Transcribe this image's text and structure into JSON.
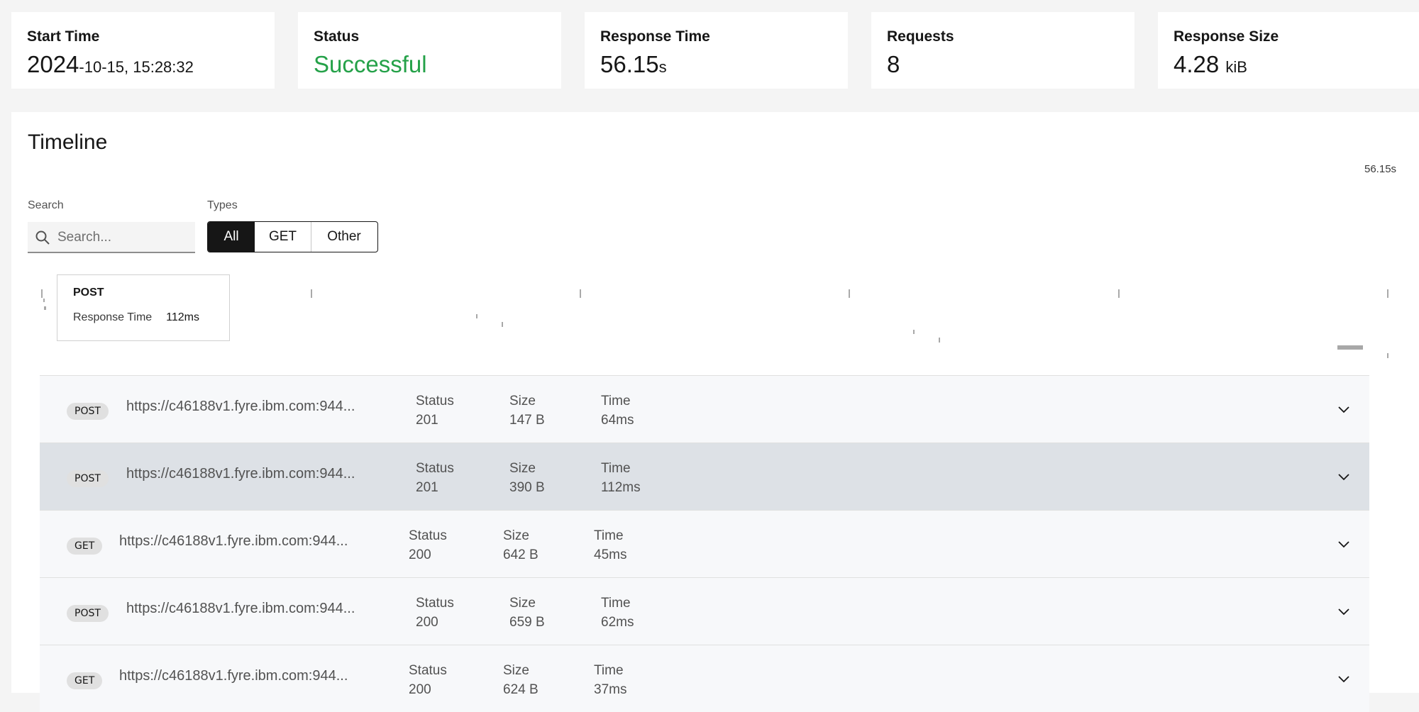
{
  "summary": {
    "start_time": {
      "label": "Start Time",
      "value_main": "2024",
      "value_rest": "-10-15, 15:28:32"
    },
    "status": {
      "label": "Status",
      "value": "Successful",
      "color": "#24a148"
    },
    "response_time": {
      "label": "Response Time",
      "value": "56.15",
      "unit": "s"
    },
    "requests": {
      "label": "Requests",
      "value": "8"
    },
    "response_size": {
      "label": "Response Size",
      "value": "4.28",
      "unit": "kiB"
    }
  },
  "timeline": {
    "title": "Timeline",
    "search": {
      "label": "Search",
      "placeholder": "Search..."
    },
    "types": {
      "label": "Types",
      "options": [
        "All",
        "GET",
        "Other"
      ],
      "selected": "All"
    },
    "axis_end_label": "56.15s",
    "tooltip": {
      "method": "POST",
      "metric_label": "Response Time",
      "metric_value": "112ms"
    }
  },
  "requests": [
    {
      "method": "POST",
      "url": "https://c46188v1.fyre.ibm.com:944...",
      "status_label": "Status",
      "status": "201",
      "size_label": "Size",
      "size": "147 B",
      "time_label": "Time",
      "time": "64ms"
    },
    {
      "method": "POST",
      "url": "https://c46188v1.fyre.ibm.com:944...",
      "status_label": "Status",
      "status": "201",
      "size_label": "Size",
      "size": "390 B",
      "time_label": "Time",
      "time": "112ms"
    },
    {
      "method": "GET",
      "url": "https://c46188v1.fyre.ibm.com:944...",
      "status_label": "Status",
      "status": "200",
      "size_label": "Size",
      "size": "642 B",
      "time_label": "Time",
      "time": "45ms"
    },
    {
      "method": "POST",
      "url": "https://c46188v1.fyre.ibm.com:944...",
      "status_label": "Status",
      "status": "200",
      "size_label": "Size",
      "size": "659 B",
      "time_label": "Time",
      "time": "62ms"
    },
    {
      "method": "GET",
      "url": "https://c46188v1.fyre.ibm.com:944...",
      "status_label": "Status",
      "status": "200",
      "size_label": "Size",
      "size": "624 B",
      "time_label": "Time",
      "time": "37ms"
    }
  ]
}
